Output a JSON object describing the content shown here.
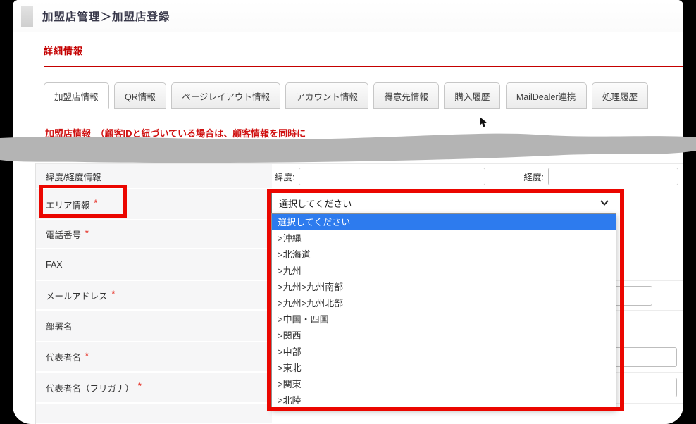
{
  "header": {
    "title": "加盟店管理＞加盟店登録"
  },
  "section": {
    "title": "詳細情報",
    "accent_color": "#c40000"
  },
  "tabs": [
    {
      "label": "加盟店情報",
      "active": true
    },
    {
      "label": "QR情報",
      "active": false
    },
    {
      "label": "ページレイアウト情報",
      "active": false
    },
    {
      "label": "アカウント情報",
      "active": false
    },
    {
      "label": "得意先情報",
      "active": false
    },
    {
      "label": "購入履歴",
      "active": false
    },
    {
      "label": "MailDealer連携",
      "active": false
    },
    {
      "label": "処理履歴",
      "active": false
    }
  ],
  "note": {
    "text_fragment": "加盟店情報　（顧客IDと紐づいている場合は、顧客情報を同時に"
  },
  "form": {
    "latitude_label": "緯度:",
    "longitude_label": "経度:",
    "latitude_value": "",
    "longitude_value": "",
    "email_value": "",
    "rep_name_value": "",
    "rep_kana_value": "",
    "rows": [
      {
        "label": "緯度/経度情報",
        "star": ""
      },
      {
        "label": "エリア情報",
        "star": "*"
      },
      {
        "label": "電話番号",
        "star": "*"
      },
      {
        "label": "FAX",
        "star": ""
      },
      {
        "label": "メールアドレス",
        "star": "*"
      },
      {
        "label": "部署名",
        "star": ""
      },
      {
        "label": "代表者名",
        "star": "*"
      },
      {
        "label": "代表者名（フリガナ）",
        "star": "*"
      },
      {
        "label": "",
        "star": ""
      }
    ]
  },
  "area_dropdown": {
    "selected": "選択してください",
    "highlight_color": "#2d7bee",
    "options": [
      "選択してください",
      ">沖縄",
      ">北海道",
      ">九州",
      ">九州>九州南部",
      ">九州>九州北部",
      ">中国・四国",
      ">関西",
      ">中部",
      ">東北",
      ">関東",
      ">北陸"
    ]
  },
  "annotations": {
    "box_color": "#eb0600",
    "redaction_color": "#b4b4b4"
  }
}
